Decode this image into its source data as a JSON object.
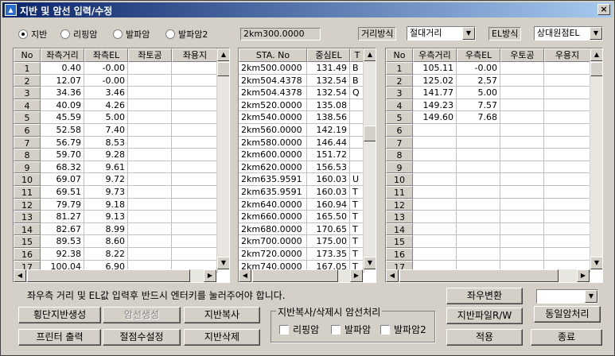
{
  "window": {
    "title": "지반 및 암선 입력/수정",
    "close": "×"
  },
  "radios": [
    {
      "label": "지반",
      "checked": true
    },
    {
      "label": "리핑암",
      "checked": false
    },
    {
      "label": "발파암",
      "checked": false
    },
    {
      "label": "발파암2",
      "checked": false
    }
  ],
  "station": "2km300.0000",
  "distance_mode": {
    "label": "거리방식",
    "value": "절대거리"
  },
  "el_mode": {
    "label": "EL방식",
    "value": "상대원점EL"
  },
  "left_table": {
    "headers": [
      "No",
      "좌측거리",
      "좌측EL",
      "좌토공",
      "좌용지"
    ],
    "rows": [
      [
        "1",
        "0.40",
        "-0.00"
      ],
      [
        "2",
        "12.07",
        "-0.00"
      ],
      [
        "3",
        "34.36",
        "3.46"
      ],
      [
        "4",
        "40.09",
        "4.26"
      ],
      [
        "5",
        "45.59",
        "5.00"
      ],
      [
        "6",
        "52.58",
        "7.40"
      ],
      [
        "7",
        "56.79",
        "8.53"
      ],
      [
        "8",
        "59.70",
        "9.28"
      ],
      [
        "9",
        "68.32",
        "9.61"
      ],
      [
        "10",
        "69.07",
        "9.72"
      ],
      [
        "11",
        "69.51",
        "9.73"
      ],
      [
        "12",
        "79.79",
        "9.18"
      ],
      [
        "13",
        "81.27",
        "9.13"
      ],
      [
        "14",
        "82.67",
        "8.99"
      ],
      [
        "15",
        "89.53",
        "8.60"
      ],
      [
        "16",
        "92.38",
        "8.22"
      ],
      [
        "17",
        "100.04",
        "6.90"
      ]
    ]
  },
  "center_table": {
    "headers": [
      "STA. No",
      "중심EL",
      "T"
    ],
    "rows": [
      [
        "2km500.0000",
        "131.49",
        "B"
      ],
      [
        "2km504.4378",
        "132.54",
        "B"
      ],
      [
        "2km504.4378",
        "132.54",
        "Q"
      ],
      [
        "2km520.0000",
        "135.08",
        ""
      ],
      [
        "2km540.0000",
        "138.56",
        ""
      ],
      [
        "2km560.0000",
        "142.19",
        ""
      ],
      [
        "2km580.0000",
        "146.44",
        ""
      ],
      [
        "2km600.0000",
        "151.72",
        ""
      ],
      [
        "2km620.0000",
        "156.53",
        ""
      ],
      [
        "2km635.9591",
        "160.03",
        "U"
      ],
      [
        "2km635.9591",
        "160.03",
        "T"
      ],
      [
        "2km640.0000",
        "160.94",
        "T"
      ],
      [
        "2km660.0000",
        "165.50",
        "T"
      ],
      [
        "2km680.0000",
        "170.65",
        "T"
      ],
      [
        "2km700.0000",
        "175.00",
        "T"
      ],
      [
        "2km720.0000",
        "173.35",
        "T"
      ],
      [
        "2km740.0000",
        "167.05",
        "T"
      ]
    ]
  },
  "right_table": {
    "headers": [
      "No",
      "우측거리",
      "우측EL",
      "우토공",
      "우용지"
    ],
    "rows": [
      [
        "1",
        "105.11",
        "-0.00"
      ],
      [
        "2",
        "125.02",
        "2.57"
      ],
      [
        "3",
        "141.77",
        "5.00"
      ],
      [
        "4",
        "149.23",
        "7.57"
      ],
      [
        "5",
        "149.60",
        "7.68"
      ],
      [
        "6",
        "",
        ""
      ],
      [
        "7",
        "",
        ""
      ],
      [
        "8",
        "",
        ""
      ],
      [
        "9",
        "",
        ""
      ],
      [
        "10",
        "",
        ""
      ],
      [
        "11",
        "",
        ""
      ],
      [
        "12",
        "",
        ""
      ],
      [
        "13",
        "",
        ""
      ],
      [
        "14",
        "",
        ""
      ],
      [
        "15",
        "",
        ""
      ],
      [
        "16",
        "",
        ""
      ],
      [
        "17",
        "",
        ""
      ]
    ]
  },
  "notice": "좌우측 거리 및 EL값 입력후 반드시 엔터키를 눌러주어야 합니다.",
  "buttons": {
    "cross_ground": "횡단지반생성",
    "rock_gen": "암선생성",
    "ground_copy": "지반복사",
    "printer": "프린터 출력",
    "node_count": "절점수설정",
    "ground_delete": "지반삭제",
    "lr_swap": "좌우변환",
    "ground_file": "지반파일R/W",
    "same_rock": "동일암처리",
    "apply": "적용",
    "close": "종료"
  },
  "group": {
    "title": "지반복사/삭제시 암선처리",
    "checks": [
      "리핑암",
      "발파암",
      "발파암2"
    ]
  }
}
